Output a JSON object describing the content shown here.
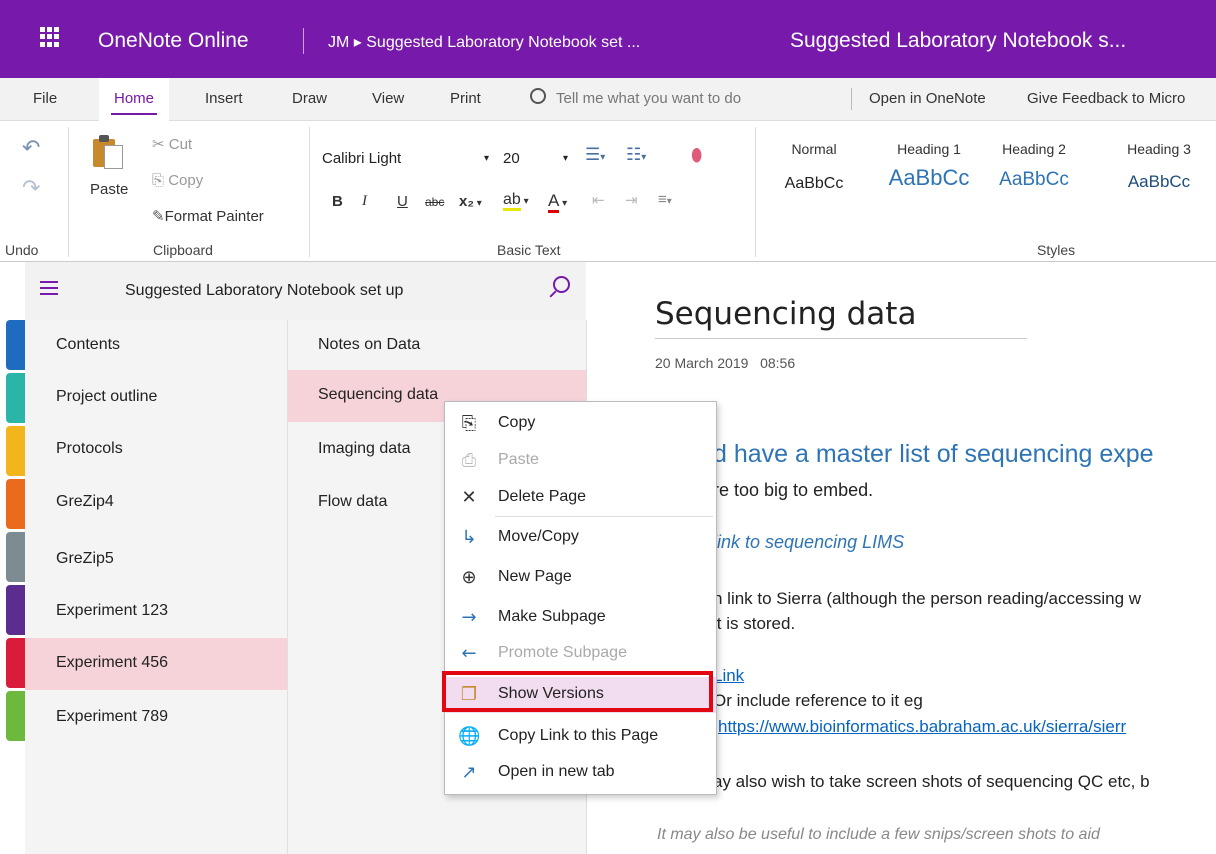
{
  "titlebar": {
    "app_name": "OneNote Online",
    "breadcrumb": "JM ▸ Suggested Laboratory Notebook set ...",
    "doc_title": "Suggested Laboratory Notebook s...",
    "color": "#7719aa"
  },
  "tabs": {
    "file": "File",
    "home": "Home",
    "insert": "Insert",
    "draw": "Draw",
    "view": "View",
    "print": "Print",
    "tell_me": "Tell me what you want to do",
    "open_in_onenote": "Open in OneNote",
    "give_feedback": "Give Feedback to Micro"
  },
  "ribbon": {
    "undo_group": "Undo",
    "clipboard": {
      "group": "Clipboard",
      "paste": "Paste",
      "cut": "Cut",
      "copy": "Copy",
      "format_painter": "Format Painter"
    },
    "basic_text": {
      "group": "Basic Text",
      "font": "Calibri Light",
      "size": "20",
      "bold": "B",
      "italic": "I",
      "underline": "U",
      "strike": "abc",
      "subscript": "x₂",
      "font_color": "A"
    },
    "styles": {
      "group": "Styles",
      "items": [
        {
          "name": "Normal",
          "sample": "AaBbCc"
        },
        {
          "name": "Heading 1",
          "sample": "AaBbCc"
        },
        {
          "name": "Heading 2",
          "sample": "AaBbCc"
        },
        {
          "name": "Heading 3",
          "sample": "AaBbCc"
        }
      ]
    }
  },
  "notebook": {
    "title": "Suggested Laboratory Notebook set up",
    "sections": [
      {
        "label": "Contents",
        "color": "#1f6bbf"
      },
      {
        "label": "Project outline",
        "color": "#2bb5a8"
      },
      {
        "label": "Protocols",
        "color": "#f2b51c"
      },
      {
        "label": "GreZip4",
        "color": "#ea6b1d"
      },
      {
        "label": "GreZip5",
        "color": "#7d8c93"
      },
      {
        "label": "Experiment 123",
        "color": "#5b2d8e"
      },
      {
        "label": "Experiment 456",
        "color": "#d91b3c"
      },
      {
        "label": "Experiment 789",
        "color": "#6cb93e"
      }
    ],
    "selected_section": "Experiment 456",
    "pages": [
      "Notes on Data",
      "Sequencing data",
      "Imaging data",
      "Flow data"
    ],
    "selected_page": "Sequencing data"
  },
  "page": {
    "title": "Sequencing data",
    "date": "20 March 2019",
    "time": "08:56",
    "heading": "d have a master list of sequencing expe",
    "line1": "re too big to embed.",
    "line2": "link to sequencing LIMS",
    "line3": "n link to Sierra (although the person reading/accessing w",
    "line4": "it is stored.",
    "link": "Link",
    "line5": "Or include reference to it eg",
    "url": "https://www.bioinformatics.babraham.ac.uk/sierra/sierr",
    "line6": "ay also wish to take screen shots of sequencing QC etc, b",
    "line7": "It may also be useful to include a few snips/screen shots to aid"
  },
  "context_menu": {
    "items": [
      {
        "label": "Copy",
        "icon": "copy-icon",
        "enabled": true
      },
      {
        "label": "Paste",
        "icon": "paste-icon",
        "enabled": false
      },
      {
        "label": "Delete Page",
        "icon": "close-icon",
        "enabled": true
      },
      {
        "label": "Move/Copy",
        "icon": "move-icon",
        "enabled": true
      },
      {
        "label": "New Page",
        "icon": "plus-circle-icon",
        "enabled": true
      },
      {
        "label": "Make Subpage",
        "icon": "arrow-right-icon",
        "enabled": true
      },
      {
        "label": "Promote Subpage",
        "icon": "arrow-left-icon",
        "enabled": false
      },
      {
        "label": "Show Versions",
        "icon": "versions-icon",
        "enabled": true,
        "highlighted": true
      },
      {
        "label": "Copy Link to this Page",
        "icon": "link-icon",
        "enabled": true
      },
      {
        "label": "Open in new tab",
        "icon": "open-new-tab-icon",
        "enabled": true
      }
    ],
    "highlight_color": "#e30613"
  }
}
